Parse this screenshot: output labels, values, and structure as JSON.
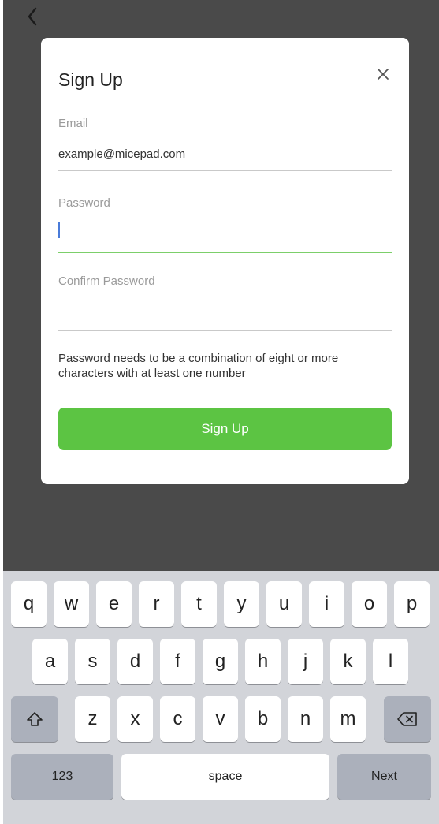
{
  "nav": {
    "back_icon": "chevron-left-icon"
  },
  "modal": {
    "title": "Sign Up",
    "close_icon": "close-icon",
    "fields": {
      "email": {
        "label": "Email",
        "value": "example@micepad.com"
      },
      "password": {
        "label": "Password",
        "value": ""
      },
      "confirm": {
        "label": "Confirm Password",
        "value": ""
      }
    },
    "hint": "Password needs to be a combination of eight or more characters with at least one number",
    "submit_label": "Sign Up"
  },
  "keyboard": {
    "row1": [
      "q",
      "w",
      "e",
      "r",
      "t",
      "y",
      "u",
      "i",
      "o",
      "p"
    ],
    "row2": [
      "a",
      "s",
      "d",
      "f",
      "g",
      "h",
      "j",
      "k",
      "l"
    ],
    "row3": [
      "z",
      "x",
      "c",
      "v",
      "b",
      "n",
      "m"
    ],
    "shift_icon": "shift-icon",
    "delete_icon": "backspace-icon",
    "numbers_label": "123",
    "space_label": "space",
    "next_label": "Next"
  },
  "colors": {
    "accent": "#5cc443",
    "backdrop": "#4a4a4a",
    "keyboard_bg": "#d2d4d9",
    "caret": "#4a7bd9"
  }
}
